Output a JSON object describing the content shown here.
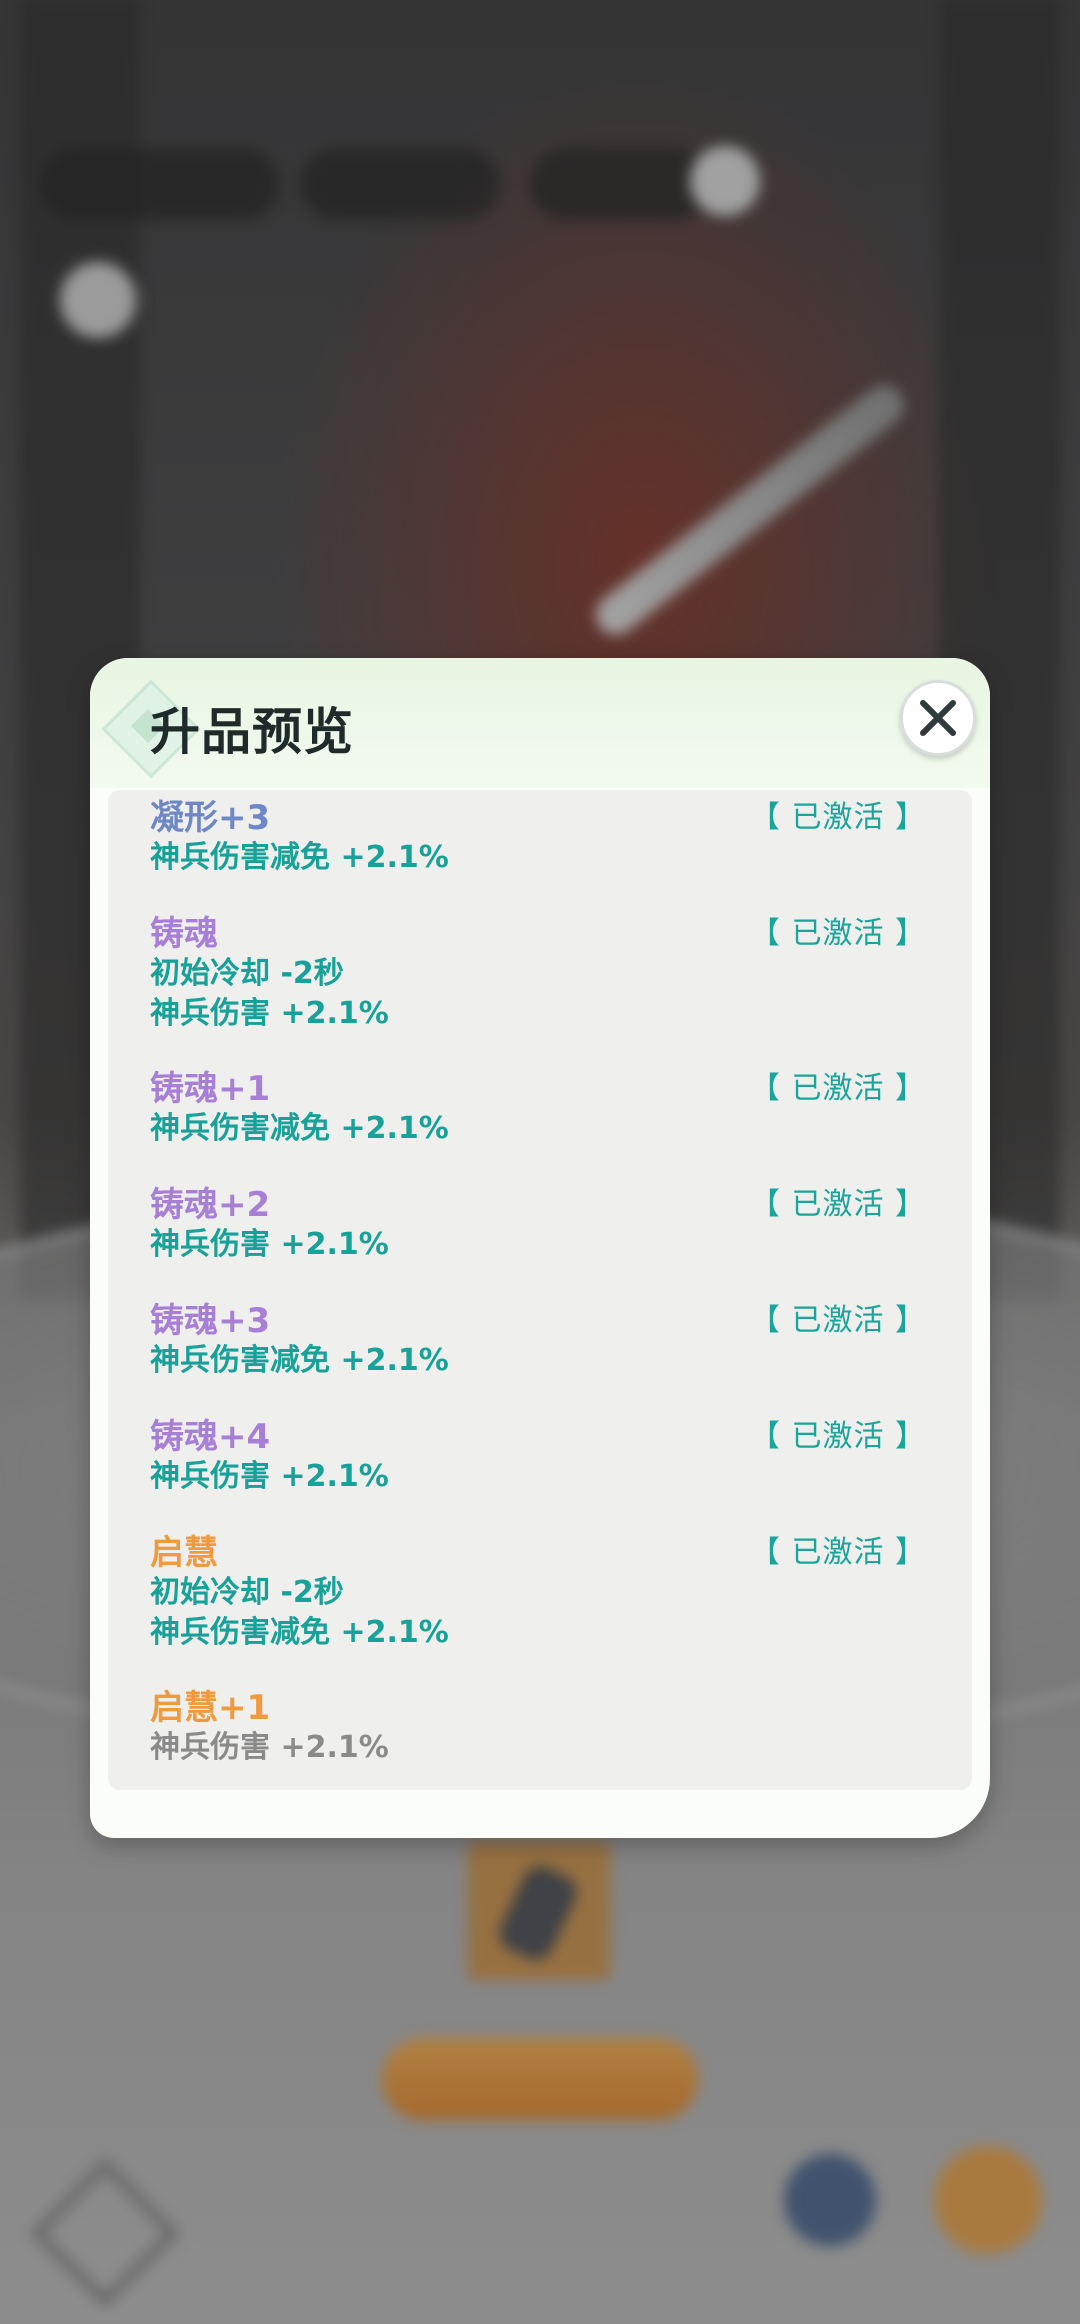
{
  "modal": {
    "title": "升品预览",
    "close_label": "close",
    "entries": [
      {
        "title": "凝形+3",
        "tier": "blue",
        "status": "【 已激活 】",
        "lines": [
          "神兵伤害减免 +2.1%"
        ]
      },
      {
        "title": "铸魂",
        "tier": "purple",
        "status": "【 已激活 】",
        "lines": [
          "初始冷却 -2秒",
          "神兵伤害 +2.1%"
        ]
      },
      {
        "title": "铸魂+1",
        "tier": "purple",
        "status": "【 已激活 】",
        "lines": [
          "神兵伤害减免 +2.1%"
        ]
      },
      {
        "title": "铸魂+2",
        "tier": "purple",
        "status": "【 已激活 】",
        "lines": [
          "神兵伤害 +2.1%"
        ]
      },
      {
        "title": "铸魂+3",
        "tier": "purple",
        "status": "【 已激活 】",
        "lines": [
          "神兵伤害减免 +2.1%"
        ]
      },
      {
        "title": "铸魂+4",
        "tier": "purple",
        "status": "【 已激活 】",
        "lines": [
          "神兵伤害 +2.1%"
        ]
      },
      {
        "title": "启慧",
        "tier": "orange",
        "status": "【 已激活 】",
        "lines": [
          "初始冷却 -2秒",
          "神兵伤害减免 +2.1%"
        ]
      },
      {
        "title": "启慧+1",
        "tier": "orange",
        "status": "",
        "lines": [
          "神兵伤害 +2.1%"
        ]
      }
    ]
  },
  "colors": {
    "active_text": "#17a198",
    "inactive_text": "#8a8a8a",
    "tier_blue": "#6e87c6",
    "tier_purple": "#a77fd6",
    "tier_orange": "#f19a3d",
    "upgrade_button": "#e8901f"
  }
}
